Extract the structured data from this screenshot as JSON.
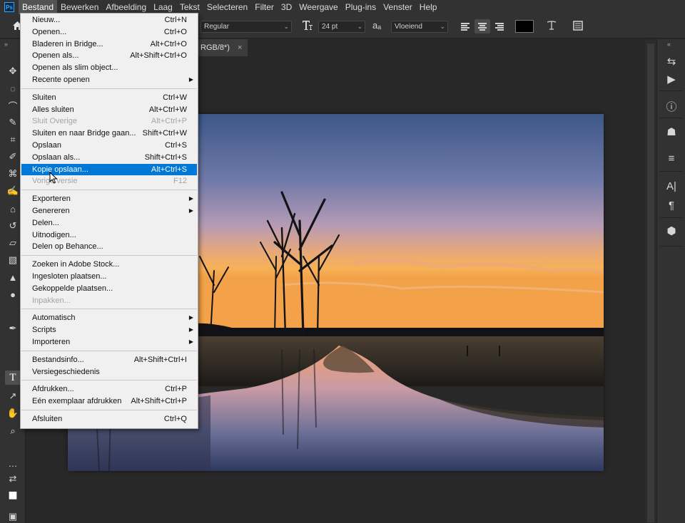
{
  "menubar": {
    "logo": "Ps",
    "items": [
      "Bestand",
      "Bewerken",
      "Afbeelding",
      "Laag",
      "Tekst",
      "Selecteren",
      "Filter",
      "3D",
      "Weergave",
      "Plug-ins",
      "Venster",
      "Help"
    ],
    "active_index": 0
  },
  "options_bar": {
    "font_style": "Regular",
    "font_size": "24 pt",
    "aa_label": "aₐ",
    "antialias": "Vloeiend",
    "text_color": "#000000"
  },
  "document_tab": {
    "title_fragment": "RGB/8*)",
    "close": "×"
  },
  "file_menu": {
    "items": [
      {
        "label": "Nieuw...",
        "shortcut": "Ctrl+N"
      },
      {
        "label": "Openen...",
        "shortcut": "Ctrl+O"
      },
      {
        "label": "Bladeren in Bridge...",
        "shortcut": "Alt+Ctrl+O"
      },
      {
        "label": "Openen als...",
        "shortcut": "Alt+Shift+Ctrl+O"
      },
      {
        "label": "Openen als slim object...",
        "shortcut": ""
      },
      {
        "label": "Recente openen",
        "shortcut": "",
        "submenu": true
      },
      {
        "separator": true
      },
      {
        "label": "Sluiten",
        "shortcut": "Ctrl+W"
      },
      {
        "label": "Alles sluiten",
        "shortcut": "Alt+Ctrl+W"
      },
      {
        "label": "Sluit Overige",
        "shortcut": "Alt+Ctrl+P",
        "disabled": true
      },
      {
        "label": "Sluiten en naar Bridge gaan...",
        "shortcut": "Shift+Ctrl+W"
      },
      {
        "label": "Opslaan",
        "shortcut": "Ctrl+S"
      },
      {
        "label": "Opslaan als...",
        "shortcut": "Shift+Ctrl+S"
      },
      {
        "label": "Kopie opslaan...",
        "shortcut": "Alt+Ctrl+S",
        "highlight": true
      },
      {
        "label": "Vorige versie",
        "shortcut": "F12",
        "disabled": true
      },
      {
        "separator": true
      },
      {
        "label": "Exporteren",
        "shortcut": "",
        "submenu": true
      },
      {
        "label": "Genereren",
        "shortcut": "",
        "submenu": true
      },
      {
        "label": "Delen...",
        "shortcut": ""
      },
      {
        "label": "Uitnodigen...",
        "shortcut": ""
      },
      {
        "label": "Delen op Behance...",
        "shortcut": ""
      },
      {
        "separator": true
      },
      {
        "label": "Zoeken in Adobe Stock...",
        "shortcut": ""
      },
      {
        "label": "Ingesloten plaatsen...",
        "shortcut": ""
      },
      {
        "label": "Gekoppelde plaatsen...",
        "shortcut": ""
      },
      {
        "label": "Inpakken...",
        "shortcut": "",
        "disabled": true
      },
      {
        "separator": true
      },
      {
        "label": "Automatisch",
        "shortcut": "",
        "submenu": true
      },
      {
        "label": "Scripts",
        "shortcut": "",
        "submenu": true
      },
      {
        "label": "Importeren",
        "shortcut": "",
        "submenu": true
      },
      {
        "separator": true
      },
      {
        "label": "Bestandsinfo...",
        "shortcut": "Alt+Shift+Ctrl+I"
      },
      {
        "label": "Versiegeschiedenis",
        "shortcut": ""
      },
      {
        "separator": true
      },
      {
        "label": "Afdrukken...",
        "shortcut": "Ctrl+P"
      },
      {
        "label": "Eén exemplaar afdrukken",
        "shortcut": "Alt+Shift+Ctrl+P"
      },
      {
        "separator": true
      },
      {
        "label": "Afsluiten",
        "shortcut": "Ctrl+Q"
      }
    ]
  },
  "tools": [
    "move-tool",
    "marquee-tool",
    "lasso-tool",
    "quick-selection-tool",
    "crop-tool",
    "eyedropper-tool",
    "spot-healing-tool",
    "brush-tool",
    "clone-stamp-tool",
    "history-brush-tool",
    "eraser-tool",
    "gradient-tool",
    "blur-tool",
    "dodge-tool",
    "pen-tool",
    "type-tool",
    "path-selection-tool",
    "hand-tool",
    "zoom-tool",
    "more-tools",
    "swap-colors",
    "color-swatches",
    "quick-mask"
  ],
  "right_panel_icons": [
    "history-icon",
    "play-icon",
    "info-icon",
    "stamp-icon",
    "adjustments-icon",
    "character-icon",
    "paragraph-icon",
    "3d-icon"
  ]
}
